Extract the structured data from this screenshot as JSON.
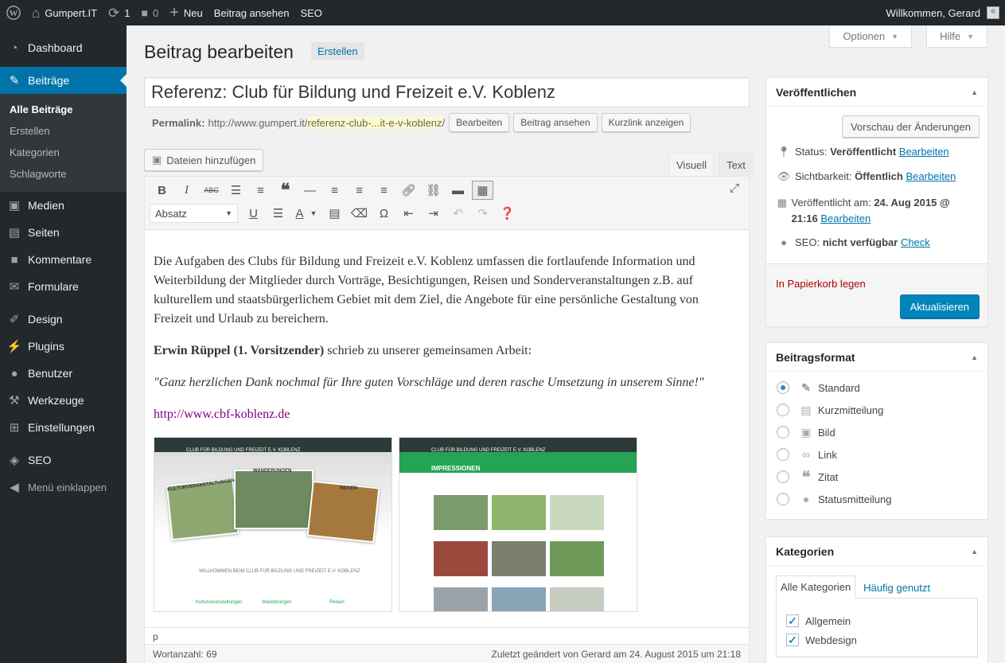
{
  "adminbar": {
    "wp_logo": "wordpress-icon",
    "site_name": "Gumpert.IT",
    "updates_count": "1",
    "comments_count": "0",
    "new_label": "Neu",
    "view_post": "Beitrag ansehen",
    "seo": "SEO",
    "greeting": "Willkommen, Gerard"
  },
  "sidebar": {
    "items": [
      {
        "label": "Dashboard",
        "icon": "dashboard-icon"
      },
      {
        "label": "Beiträge",
        "icon": "pin-icon"
      },
      {
        "label": "Medien",
        "icon": "media-icon"
      },
      {
        "label": "Seiten",
        "icon": "pages-icon"
      },
      {
        "label": "Kommentare",
        "icon": "comments-icon"
      },
      {
        "label": "Formulare",
        "icon": "mail-icon"
      },
      {
        "label": "Design",
        "icon": "brush-icon"
      },
      {
        "label": "Plugins",
        "icon": "plugin-icon"
      },
      {
        "label": "Benutzer",
        "icon": "users-icon"
      },
      {
        "label": "Werkzeuge",
        "icon": "wrench-icon"
      },
      {
        "label": "Einstellungen",
        "icon": "settings-icon"
      },
      {
        "label": "SEO",
        "icon": "seo-icon"
      }
    ],
    "submenu": [
      "Alle Beiträge",
      "Erstellen",
      "Kategorien",
      "Schlagworte"
    ],
    "collapse": "Menü einklappen"
  },
  "screen_tabs": {
    "options": "Optionen",
    "help": "Hilfe"
  },
  "header": {
    "title": "Beitrag bearbeiten",
    "add_new": "Erstellen"
  },
  "post": {
    "title": "Referenz: Club für Bildung und Freizeit e.V. Koblenz",
    "permalink_label": "Permalink:",
    "permalink_base": "http://www.gumpert.it/",
    "permalink_slug": "referenz-club-...it-e-v-koblenz",
    "permalink_end": "/",
    "edit_btn": "Bearbeiten",
    "view_btn": "Beitrag ansehen",
    "shortlink_btn": "Kurzlink anzeigen"
  },
  "editor": {
    "add_media": "Dateien hinzufügen",
    "tab_visual": "Visuell",
    "tab_text": "Text",
    "format_select": "Absatz",
    "paragraph1": "Die Aufgaben des Clubs für Bildung und Freizeit e.V. Koblenz umfassen die fortlaufende Information und Weiterbildung der Mitglieder durch Vorträge, Besichtigungen, Reisen und Sonderveranstaltungen z.B. auf kulturellem und staatsbürgerlichem Gebiet mit dem Ziel, die Angebote für eine persönliche Gestaltung von Freizeit und Urlaub zu bereichern.",
    "bold_name": "Erwin Rüppel (1. Vorsitzender)",
    "paragraph2_rest": " schrieb zu unserer gemeinsamen Arbeit:",
    "quote": "\"Ganz herzlichen Dank nochmal für Ihre guten Vorschläge und deren rasche Umsetzung in unserem Sinne!\"",
    "link": "http://www.cbf-koblenz.de",
    "shot1": {
      "site_title": "CLUB FÜR BILDUNG UND FREIZEIT E.V. KOBLENZ",
      "label_kultur": "KULTURVERANSTALTUNGEN",
      "label_wander": "WANDERUNGEN",
      "label_reisen": "REISEN",
      "welcome": "WILLKOMMEN BEIM CLUB FÜR BILDUNG UND FREIZEIT E.V. KOBLENZ",
      "f1": "Kulturveranstaltungen",
      "f2": "Wanderungen",
      "f3": "Reisen"
    },
    "shot2": {
      "site_title": "CLUB FÜR BILDUNG UND FREIZEIT E.V. KOBLENZ",
      "heading": "IMPRESSIONEN"
    },
    "path": "p",
    "word_count": "Wortanzahl: 69",
    "last_edited": "Zuletzt geändert von Gerard am 24. August 2015 um 21:18"
  },
  "publish": {
    "title": "Veröffentlichen",
    "preview_btn": "Vorschau der Änderungen",
    "status_label": "Status: ",
    "status_value": "Veröffentlicht",
    "visibility_label": "Sichtbarkeit: ",
    "visibility_value": "Öffentlich",
    "published_label": "Veröffentlicht am: ",
    "published_value": "24. Aug 2015 @ 21:16",
    "seo_label": "SEO: ",
    "seo_value": "nicht verfügbar",
    "seo_check": "Check",
    "edit_link": "Bearbeiten",
    "trash": "In Papierkorb legen",
    "update_btn": "Aktualisieren"
  },
  "post_format": {
    "title": "Beitragsformat",
    "options": [
      "Standard",
      "Kurzmitteilung",
      "Bild",
      "Link",
      "Zitat",
      "Statusmitteilung"
    ],
    "selected": "Standard"
  },
  "categories": {
    "title": "Kategorien",
    "tab_all": "Alle Kategorien",
    "tab_popular": "Häufig genutzt",
    "items": [
      {
        "label": "Allgemein",
        "checked": true
      },
      {
        "label": "Webdesign",
        "checked": true
      }
    ]
  },
  "colors": {
    "accent": "#0073aa",
    "primary_button": "#0085ba",
    "admin_dark": "#23282d",
    "green": "#25a553"
  }
}
